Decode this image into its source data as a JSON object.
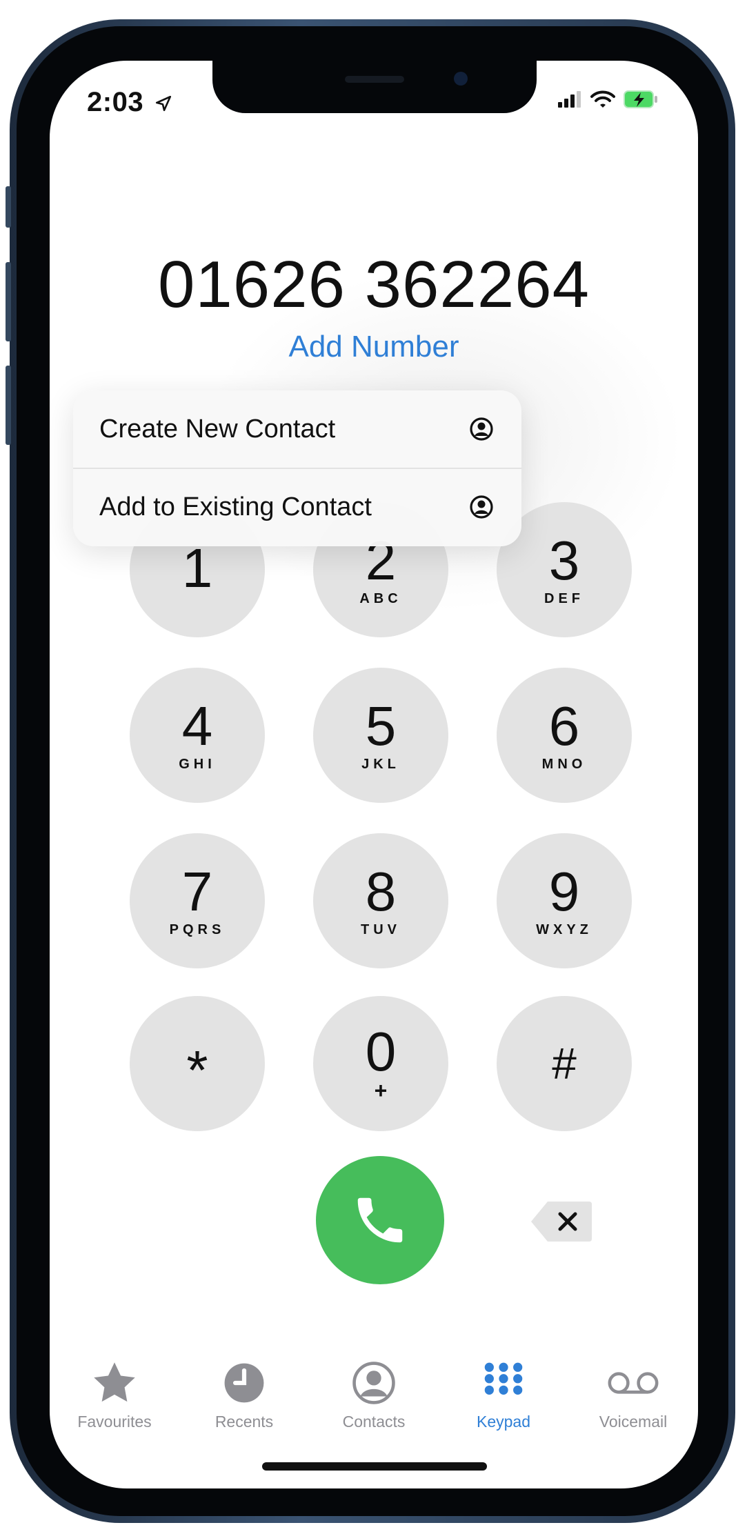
{
  "status_bar": {
    "time": "2:03"
  },
  "dialer": {
    "number": "01626 362264",
    "add_number": "Add Number"
  },
  "context_menu": {
    "items": [
      {
        "label": "Create New Contact",
        "icon": "person-circle-icon"
      },
      {
        "label": "Add to Existing Contact",
        "icon": "person-circle-icon"
      }
    ]
  },
  "keypad": {
    "keys": [
      {
        "digit": "1",
        "letters": ""
      },
      {
        "digit": "2",
        "letters": "ABC"
      },
      {
        "digit": "3",
        "letters": "DEF"
      },
      {
        "digit": "4",
        "letters": "GHI"
      },
      {
        "digit": "5",
        "letters": "JKL"
      },
      {
        "digit": "6",
        "letters": "MNO"
      },
      {
        "digit": "7",
        "letters": "PQRS"
      },
      {
        "digit": "8",
        "letters": "TUV"
      },
      {
        "digit": "9",
        "letters": "WXYZ"
      },
      {
        "digit": "*",
        "letters": ""
      },
      {
        "digit": "0",
        "letters": "+"
      },
      {
        "digit": "#",
        "letters": ""
      }
    ],
    "call_icon": "phone-icon",
    "delete_icon": "delete-backspace-icon"
  },
  "tab_bar": {
    "tabs": [
      {
        "label": "Favourites",
        "icon": "star-icon"
      },
      {
        "label": "Recents",
        "icon": "clock-icon"
      },
      {
        "label": "Contacts",
        "icon": "person-circle-icon"
      },
      {
        "label": "Keypad",
        "icon": "keypad-icon"
      },
      {
        "label": "Voicemail",
        "icon": "voicemail-icon"
      }
    ],
    "active": "Keypad"
  },
  "colors": {
    "accent": "#2f7fd6",
    "call_green": "#46bd5b",
    "key_gray": "#e3e3e3",
    "battery_green": "#4cd964"
  }
}
